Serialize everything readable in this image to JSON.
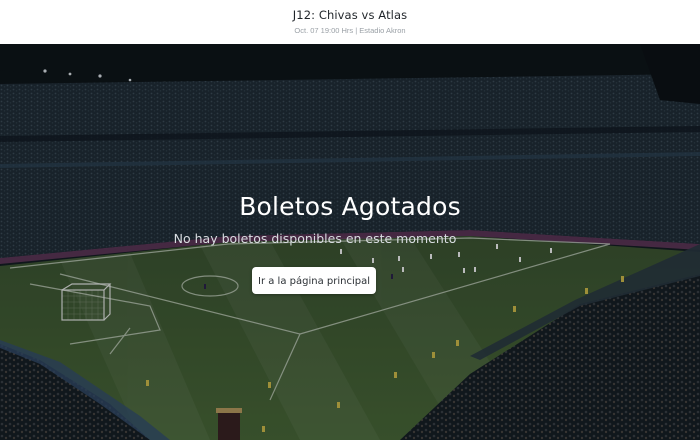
{
  "header": {
    "title": "J12: Chivas vs Atlas",
    "subtitle": "Oct. 07 19:00 Hrs | Estadio Akron"
  },
  "hero": {
    "headline": "Boletos Agotados",
    "message": "No hay boletos disponibles en este momento",
    "button_label": "Ir a la página principal",
    "background": "stadium-photo"
  },
  "colors": {
    "pitch": "#3f5a30",
    "pitch_dark": "#2f4624",
    "stands": "#1c2a33",
    "button_bg": "#ffffff"
  }
}
